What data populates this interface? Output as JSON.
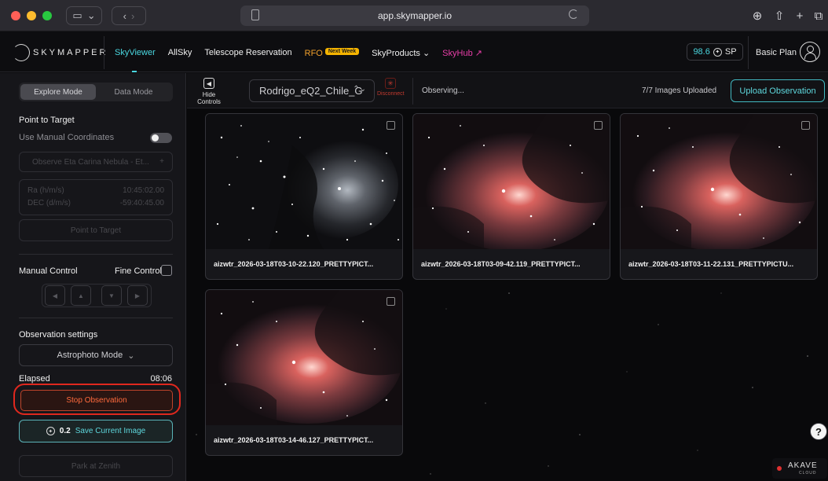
{
  "browser": {
    "url": "app.skymapper.io"
  },
  "header": {
    "logo_text": "SKYMAPPER",
    "nav": [
      {
        "label": "SkyViewer",
        "active": true
      },
      {
        "label": "AllSky"
      },
      {
        "label": "Telescope Reservation"
      },
      {
        "label": "RFO",
        "badge": "Next Week"
      },
      {
        "label": "SkyProducts ⌄"
      },
      {
        "label": "SkyHub ↗"
      }
    ],
    "sp_balance": "98.6",
    "sp_unit": "SP",
    "plan": "Basic Plan",
    "accent_color": "#4ad7e0"
  },
  "sidebar": {
    "modes": {
      "active": "Explore Mode",
      "other": "Data Mode"
    },
    "point_to_target_heading": "Point to Target",
    "manual_coords_label": "Use Manual Coordinates",
    "observe_placeholder": "Observe Eta Carina Nebula - Et...",
    "ra_label": "Ra (h/m/s)",
    "ra_value": "10:45:02.00",
    "dec_label": "DEC (d/m/s)",
    "dec_value": "-59:40:45.00",
    "point_button": "Point to Target",
    "manual_control_label": "Manual Control",
    "fine_control_label": "Fine Control",
    "observation_settings_label": "Observation settings",
    "mode_select": "Astrophoto Mode",
    "elapsed_label": "Elapsed",
    "elapsed_value": "08:06",
    "stop_button": "Stop Observation",
    "save_cost": "0.2",
    "save_button": "Save Current Image",
    "park_button": "Park at Zenith"
  },
  "toolbar": {
    "hide_controls": "Hide Controls",
    "telescope": "Rodrigo_eQ2_Chile_G",
    "disconnect": "Disconnect",
    "status": "Observing...",
    "upload_count": "7/7 Images Uploaded",
    "upload_button": "Upload Observation"
  },
  "images": [
    {
      "name": "aizwtr_2026-03-18T03-10-22.120_PRETTYPICT...",
      "tint": "mono"
    },
    {
      "name": "aizwtr_2026-03-18T03-09-42.119_PRETTYPICT...",
      "tint": "color"
    },
    {
      "name": "aizwtr_2026-03-18T03-11-22.131_PRETTYPICTU...",
      "tint": "color"
    },
    {
      "name": "aizwtr_2026-03-18T03-14-46.127_PRETTYPICT...",
      "tint": "color"
    }
  ],
  "akave": {
    "name": "AKAVE",
    "sub": "CLOUD"
  }
}
